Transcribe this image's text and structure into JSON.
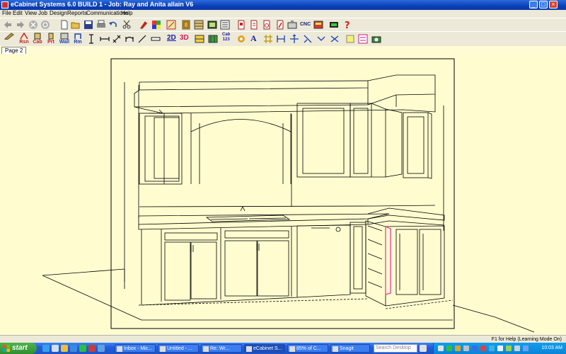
{
  "window": {
    "title": "eCabinet Systems 6.0 BUILD 1 - Job: Ray and Anita allain V6",
    "buttons": [
      "_",
      "□",
      "×"
    ]
  },
  "menu": [
    "File",
    "Edit",
    "View",
    "Job",
    "Design",
    "Reports",
    "Communications",
    "Help"
  ],
  "toolbar_top": {
    "icons": [
      "back-arrow-icon",
      "forward-arrow-icon",
      "stop-icon",
      "refresh-icon",
      "new-document-icon",
      "open-folder-icon",
      "save-icon",
      "print-icon",
      "undo-icon",
      "scissors-icon",
      "paint-icon",
      "color-palette-icon",
      "cabinet-library-icon",
      "door-library-icon",
      "drawer-library-icon",
      "material-icon",
      "report-icon",
      "cutlist-icon",
      "invoice-icon",
      "edit-report-icon",
      "optimizer-icon",
      "tooling-icon",
      "cnc-label",
      "nesting-icon",
      "machine-icon",
      "help-icon"
    ],
    "cnc_label": "CNC"
  },
  "toolbar_bottom": {
    "buttons": [
      {
        "label": "",
        "icon": "pencil-icon"
      },
      {
        "label": "Rsn",
        "icon": "room-icon"
      },
      {
        "label": "Cab",
        "icon": "cabinet-icon"
      },
      {
        "label": "Prt",
        "icon": "part-icon"
      },
      {
        "label": "Wall",
        "icon": "wall-icon"
      },
      {
        "label": "Rm",
        "icon": "room-draw-icon"
      }
    ],
    "view_2d": "2D",
    "view_3d": "3D",
    "cab_label": "Cab",
    "cab_num": "123",
    "text_label": "A"
  },
  "tabs": [
    "Page 2"
  ],
  "status": {
    "text": "F1 for Help (Learning Mode On)"
  },
  "taskbar": {
    "start": "start",
    "tasks": [
      "Inbox - Mic...",
      "Untitled - ...",
      "Re: Wr...",
      "eCabinet S...",
      "85% of C..."
    ],
    "snagit": "Snagit",
    "search_placeholder": "Search Desktop",
    "clock": "10:03 AM"
  },
  "colors": {
    "canvas": "#fffdd0",
    "titlebar": "#0a3fb6",
    "tray": "#0a84d6"
  }
}
